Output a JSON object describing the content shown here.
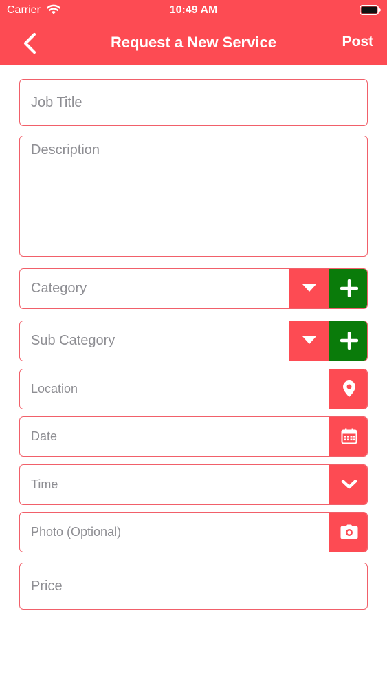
{
  "status_bar": {
    "carrier": "Carrier",
    "time": "10:49 AM"
  },
  "header": {
    "title": "Request a New Service",
    "post_label": "Post"
  },
  "form": {
    "job_title": {
      "placeholder": "Job Title"
    },
    "description": {
      "placeholder": "Description"
    },
    "category": {
      "placeholder": "Category",
      "dropdown_icon": "caret-down-icon",
      "add_icon": "plus-icon"
    },
    "sub_category": {
      "placeholder": "Sub Category",
      "dropdown_icon": "caret-down-icon",
      "add_icon": "plus-icon"
    },
    "location": {
      "placeholder": "Location",
      "icon": "map-pin-icon"
    },
    "date": {
      "placeholder": "Date",
      "icon": "calendar-icon"
    },
    "time": {
      "placeholder": "Time",
      "icon": "chevron-down-icon"
    },
    "photo": {
      "placeholder": "Photo (Optional)",
      "icon": "camera-icon"
    },
    "price": {
      "placeholder": "Price"
    }
  },
  "colors": {
    "accent": "#fd4b53",
    "add_button": "#0a7b0a",
    "field_border": "#f1606a",
    "placeholder": "#8e8e93"
  }
}
